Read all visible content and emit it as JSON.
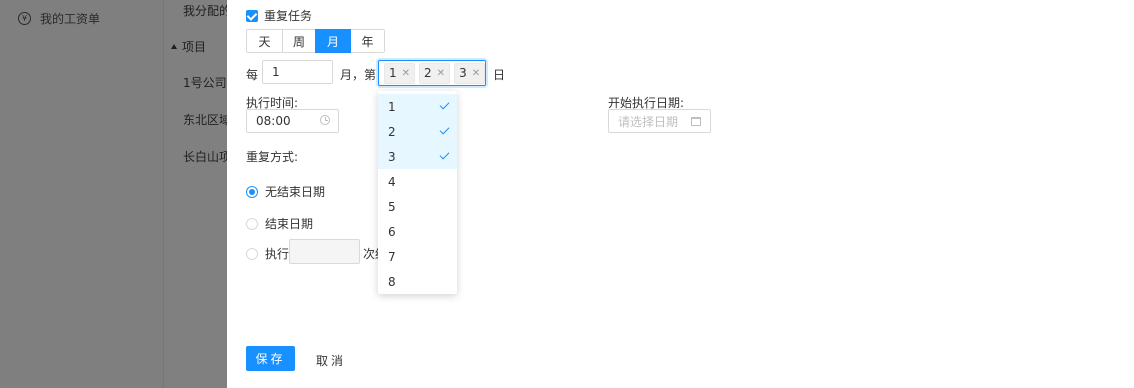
{
  "background": {
    "sidebar_item": {
      "icon": "¥",
      "label": "我的工资单"
    },
    "content_lines": [
      {
        "text": "我分配的"
      },
      {
        "text": "项目",
        "tree_toggle": true
      },
      {
        "text": "1号公司"
      },
      {
        "text": "东北区域"
      },
      {
        "text": "长白山项"
      }
    ]
  },
  "form": {
    "repeat_task": {
      "label": "重复任务",
      "checked": true
    },
    "frequency": {
      "options": [
        "天",
        "周",
        "月",
        "年"
      ],
      "selected": "月"
    },
    "interval": {
      "prefix": "每",
      "value": "1",
      "unit": "月，第",
      "suffix": "日",
      "selected_days": [
        "1",
        "2",
        "3"
      ]
    },
    "exec_time": {
      "label": "执行时间:",
      "value": "08:00"
    },
    "start_date": {
      "label": "开始执行日期:",
      "placeholder": "请选择日期"
    },
    "repeat_mode": {
      "label": "重复方式:",
      "options": [
        {
          "label": "无结束日期",
          "checked": true
        },
        {
          "label": "结束日期",
          "checked": false
        },
        {
          "label": "执行",
          "suffix": "次结",
          "checked": false
        }
      ]
    },
    "day_dropdown": {
      "options": [
        {
          "label": "1",
          "selected": true
        },
        {
          "label": "2",
          "selected": true
        },
        {
          "label": "3",
          "selected": true
        },
        {
          "label": "4",
          "selected": false
        },
        {
          "label": "5",
          "selected": false
        },
        {
          "label": "6",
          "selected": false
        },
        {
          "label": "7",
          "selected": false
        },
        {
          "label": "8",
          "selected": false
        }
      ]
    }
  },
  "footer": {
    "save": "保存",
    "cancel": "取消"
  },
  "colors": {
    "primary": "#1890ff",
    "overlay": "#808080",
    "selected_bg": "#e6f7ff"
  }
}
